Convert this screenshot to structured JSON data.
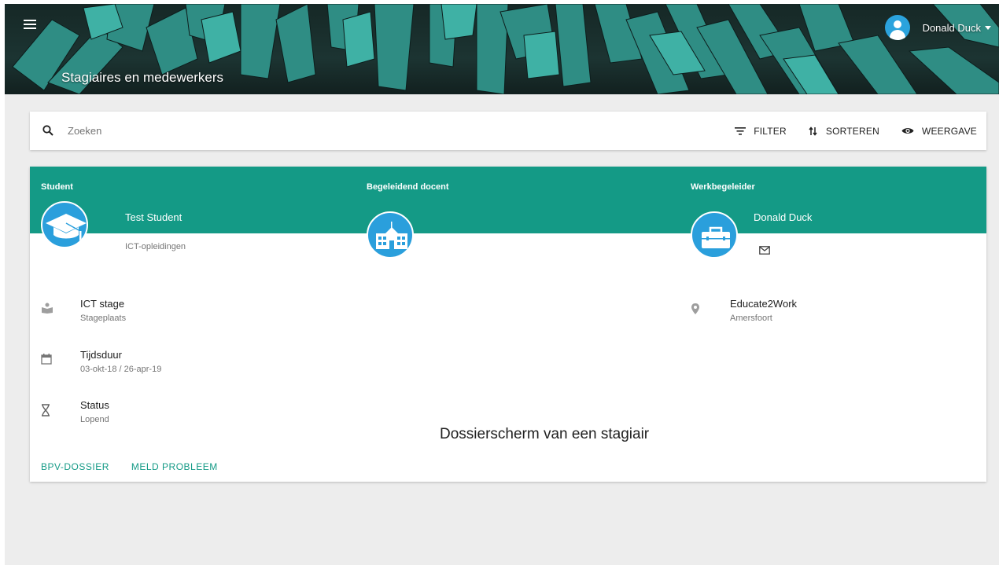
{
  "header": {
    "title": "Stagiaires en medewerkers",
    "user_name": "Donald Duck"
  },
  "search": {
    "placeholder": "Zoeken",
    "tools": [
      {
        "label": "FILTER",
        "icon": "filter-icon"
      },
      {
        "label": "SORTEREN",
        "icon": "sort-icon"
      },
      {
        "label": "WEERGAVE",
        "icon": "eye-icon"
      }
    ]
  },
  "card": {
    "columns": {
      "student": {
        "label": "Student",
        "name": "Test Student",
        "subtitle": "ICT-opleidingen",
        "icon": "graduation-cap-icon"
      },
      "docent": {
        "label": "Begeleidend docent",
        "icon": "school-building-icon"
      },
      "werkbegeleider": {
        "label": "Werkbegeleider",
        "name": "Donald Duck",
        "icon": "briefcase-icon"
      }
    },
    "details": [
      {
        "title": "ICT stage",
        "subtitle": "Stageplaats",
        "icon": "book-icon"
      },
      {
        "title": "Tijdsduur",
        "subtitle": "03-okt-18 / 26-apr-19",
        "icon": "calendar-icon"
      },
      {
        "title": "Status",
        "subtitle": "Lopend",
        "icon": "hourglass-icon"
      }
    ],
    "company": {
      "title": "Educate2Work",
      "subtitle": "Amersfoort",
      "icon": "location-icon"
    },
    "caption": "Dossierscherm van een stagiair",
    "actions": [
      "BPV-DOSSIER",
      "MELD PROBLEEM"
    ]
  },
  "colors": {
    "accent": "#149a86",
    "avatar": "#2a9fdc",
    "background": "#ededed"
  }
}
